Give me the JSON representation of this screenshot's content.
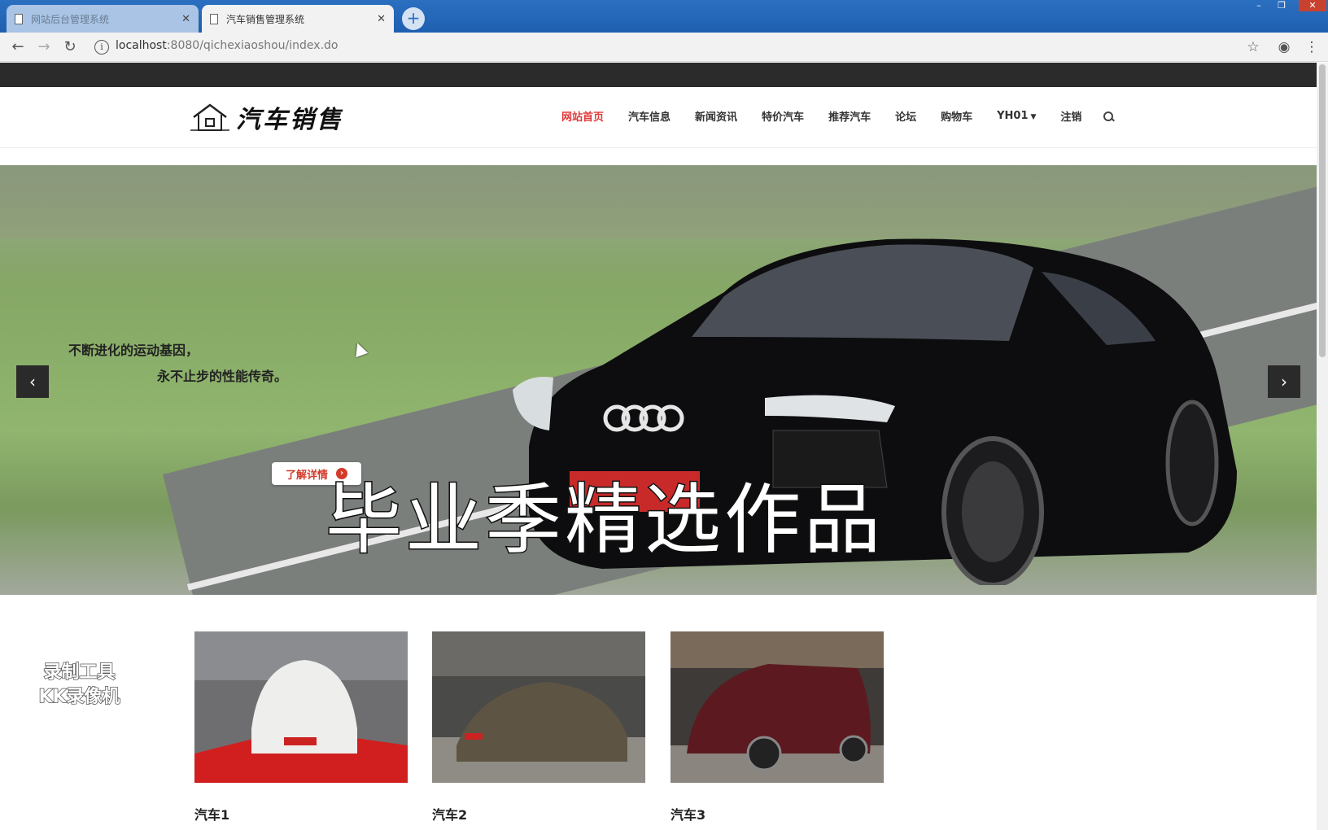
{
  "browser": {
    "tabs": [
      {
        "title": "网站后台管理系统"
      },
      {
        "title": "汽车销售管理系统"
      }
    ],
    "url_host": "localhost",
    "url_path": ":8080/qichexiaoshou/index.do"
  },
  "site": {
    "logo_text": "汽车销售",
    "nav": [
      {
        "label": "网站首页"
      },
      {
        "label": "汽车信息"
      },
      {
        "label": "新闻资讯"
      },
      {
        "label": "特价汽车"
      },
      {
        "label": "推荐汽车"
      },
      {
        "label": "论坛"
      },
      {
        "label": "购物车"
      },
      {
        "label": "YH01"
      },
      {
        "label": "注销"
      }
    ],
    "colors": {
      "active_nav": "#e03a3a",
      "top_strip": "#2b2b2b"
    }
  },
  "banner": {
    "line1": "不断进化的运动基因，",
    "line2": "永不止步的性能传奇。",
    "more_label": "了解详情",
    "caption": "毕业季精选作品"
  },
  "products": [
    {
      "name": "汽车1"
    },
    {
      "name": "汽车2"
    },
    {
      "name": "汽车3"
    }
  ],
  "watermark": {
    "line1": "录制工具",
    "line2": "KK录像机"
  }
}
